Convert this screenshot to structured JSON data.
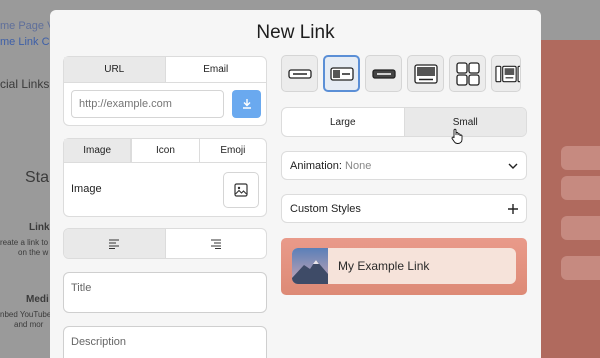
{
  "background": {
    "line1": "me Page Vi",
    "line2": "me Link Cli",
    "social_heading": "cial Links",
    "start_text": "Star",
    "link_label": "Link",
    "link_desc1": "reate a link to",
    "link_desc2": "on the w",
    "media_label": "Medi",
    "media_desc1": "nbed YouTube",
    "media_desc2": "and mor"
  },
  "modal": {
    "title": "New Link",
    "url_tabs": [
      "URL",
      "Email"
    ],
    "url_placeholder": "http://example.com",
    "icon_tabs": [
      "Image",
      "Icon",
      "Emoji"
    ],
    "image_label": "Image",
    "title_placeholder": "Title",
    "description_placeholder": "Description",
    "size_options": [
      "Large",
      "Small"
    ],
    "animation_label": "Animation:",
    "animation_value": "None",
    "custom_styles_label": "Custom Styles",
    "preview_text": "My Example Link"
  },
  "colors": {
    "accent": "#6aa9ef",
    "selected_border": "#5b8fd6",
    "preview_bg": "#e99a8a",
    "preview_link_bg": "#f6e3da"
  }
}
